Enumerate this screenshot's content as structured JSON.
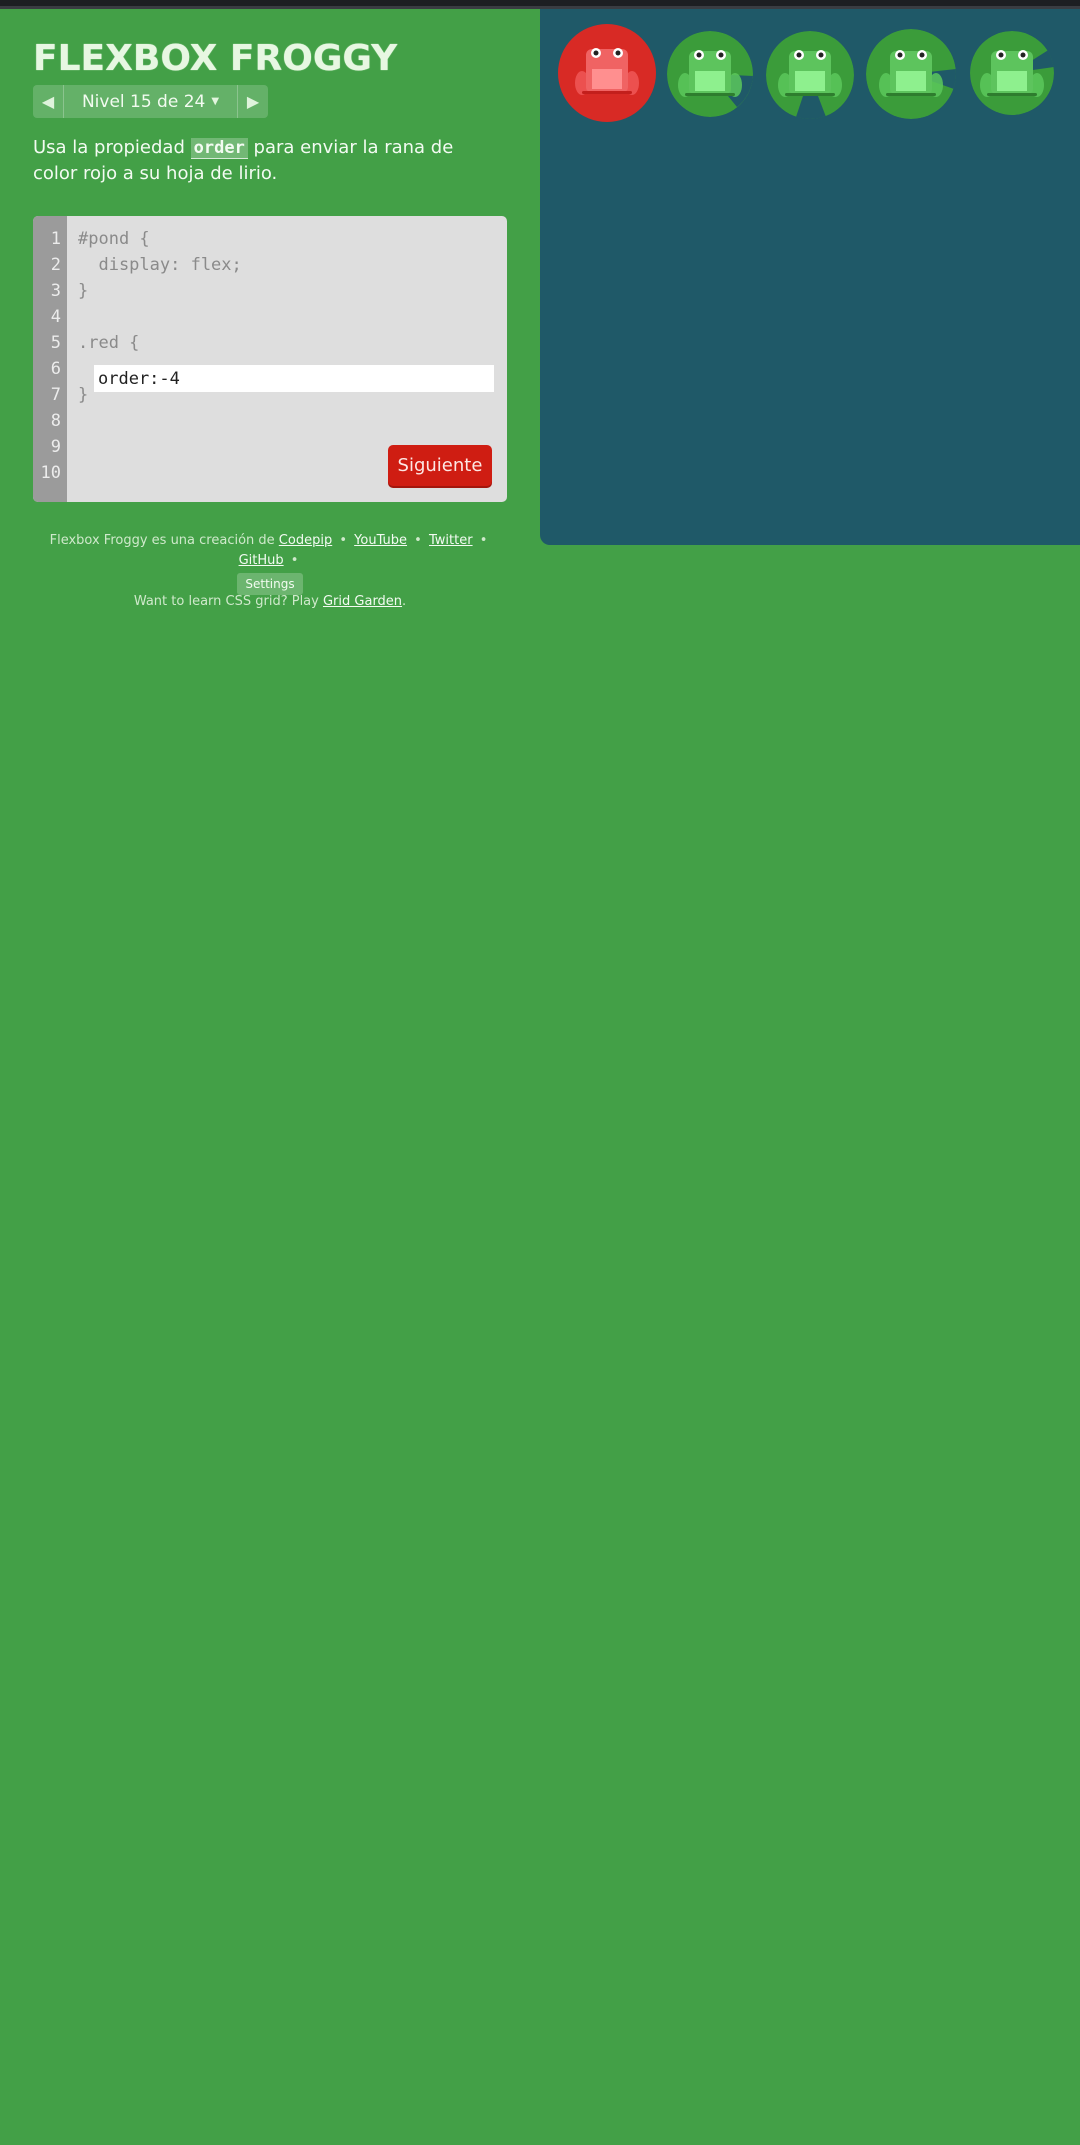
{
  "app": {
    "title": "FLEXBOX FROGGY"
  },
  "level_nav": {
    "label": "Nivel 15 de 24",
    "prev_icon": "triangle-left-icon",
    "next_icon": "triangle-right-icon",
    "dropdown_icon": "caret-down-icon"
  },
  "instructions": {
    "prefix": "Usa la propiedad",
    "keyword": "order",
    "suffix": "para enviar la rana de color rojo a su hoja de lirio."
  },
  "editor": {
    "line_numbers": [
      "1",
      "2",
      "3",
      "4",
      "5",
      "6",
      "7",
      "8",
      "9",
      "10"
    ],
    "lines": [
      "#pond {",
      "  display: flex;",
      "}",
      "",
      ".red {",
      "",
      "}",
      "",
      "",
      ""
    ],
    "answer_value": "order:-4",
    "next_label": "Siguiente"
  },
  "credits": {
    "text": "Flexbox Froggy es una creación de",
    "codepip": "Codepip",
    "youtube": "YouTube",
    "twitter": "Twitter",
    "github": "GitHub",
    "sep": "•",
    "settings": "Settings"
  },
  "promo": {
    "text": "Want to learn CSS grid? Play",
    "link": "Grid Garden",
    "end": "."
  },
  "board": {
    "frogs": [
      "red",
      "green",
      "green",
      "green",
      "green"
    ],
    "colors": {
      "water": "#1f5968",
      "red_lily": "#d82a25",
      "red_frog": "#f25c5c",
      "green_lily": "#3b9c3a",
      "green_frog": "#6fd46f"
    }
  }
}
